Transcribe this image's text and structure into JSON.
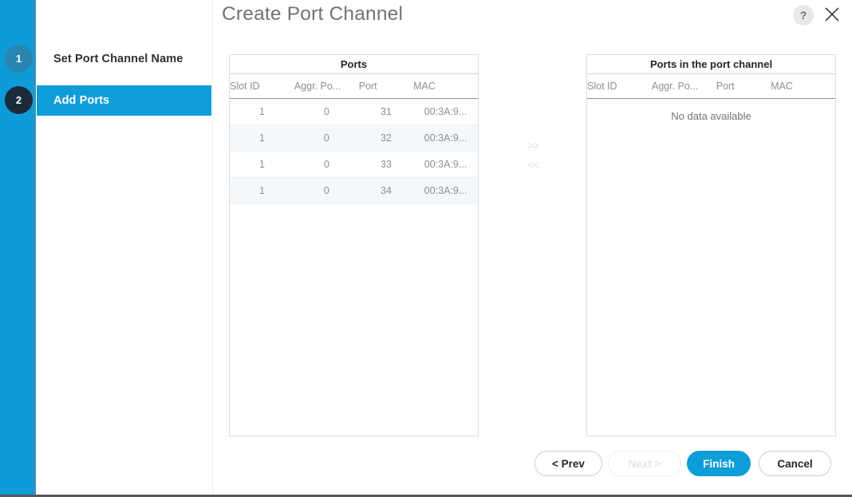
{
  "header": {
    "title": "Create Port Channel",
    "help_icon": "question-mark-icon",
    "help_label": "?",
    "close_icon": "close-icon"
  },
  "wizard": {
    "steps": [
      {
        "number": "1",
        "label": "Set Port Channel Name",
        "active": false
      },
      {
        "number": "2",
        "label": "Add Ports",
        "active": true
      }
    ]
  },
  "transfer": {
    "add_label": ">>",
    "remove_label": "<<"
  },
  "available_ports": {
    "title": "Ports",
    "columns": [
      "Slot ID",
      "Aggr. Po...",
      "Port",
      "MAC"
    ],
    "rows": [
      {
        "slot_id": "1",
        "aggr_port": "0",
        "port": "31",
        "mac": "00:3A:9..."
      },
      {
        "slot_id": "1",
        "aggr_port": "0",
        "port": "32",
        "mac": "00:3A:9..."
      },
      {
        "slot_id": "1",
        "aggr_port": "0",
        "port": "33",
        "mac": "00:3A:9..."
      },
      {
        "slot_id": "1",
        "aggr_port": "0",
        "port": "34",
        "mac": "00:3A:9..."
      }
    ]
  },
  "selected_ports": {
    "title": "Ports in the port channel",
    "columns": [
      "Slot ID",
      "Aggr. Po...",
      "Port",
      "MAC"
    ],
    "rows": [],
    "empty_message": "No data available"
  },
  "footer": {
    "prev_label": "< Prev",
    "next_label": "Next >",
    "finish_label": "Finish",
    "cancel_label": "Cancel"
  },
  "colors": {
    "accent_blue": "#0e9dd8",
    "step_inactive": "#2a85b0",
    "step_active": "#1c2b3a",
    "text_muted": "#8b8f93"
  }
}
